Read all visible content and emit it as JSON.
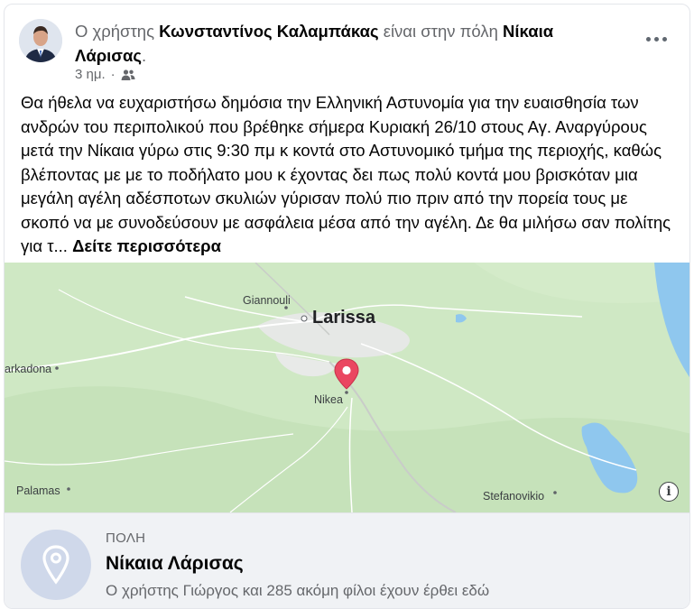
{
  "post": {
    "header_prefix": "Ο χρήστης",
    "author_name": "Κωνσταντίνος Καλαμπάκας",
    "header_middle": "είναι στην πόλη",
    "location_name": "Νίκαια Λάρισας",
    "header_suffix": ".",
    "time": "3 ημ.",
    "separator": "·",
    "privacy_icon": "friends-icon",
    "more_icon": "more-horizontal-icon",
    "body": "Θα ήθελα να ευχαριστήσω δημόσια την Ελληνική Αστυνομία για την ευαισθησία των ανδρών του περιπολικού που βρέθηκε σήμερα Κυριακή 26/10 στους Αγ. Αναργύρους μετά την Νίκαια γύρω στις 9:30 πμ κ κοντά στο Αστυνομικό τμήμα της περιοχής, καθώς  βλέποντας με με το ποδήλατο μου κ έχοντας δει πως πολύ κοντά μου βρισκόταν μια μεγάλη αγέλη αδέσποτων σκυλιών γύρισαν πολύ πιο πριν από την πορεία τους με σκοπό να με συνοδεύσουν με ασφάλεια μέσα από την αγέλη. Δε θα μιλήσω σαν πολίτης για τ...",
    "see_more": "Δείτε περισσότερα"
  },
  "map": {
    "labels": {
      "larissa": "Larissa",
      "giannouli": "Giannouli",
      "farkadona": "arkadona",
      "nikea": "Nikea",
      "palamas": "Palamas",
      "stefanovikio": "Stefanovikio"
    },
    "info_glyph": "i",
    "colors": {
      "land": "#cfe8c4",
      "urban": "#e6e8e6",
      "water": "#8fc7ee",
      "road": "#f4f4f4",
      "pin": "#ea4761"
    }
  },
  "place": {
    "category": "ΠΟΛΗ",
    "name": "Νίκαια Λάρισας",
    "visits": "Ο χρήστης Γιώργος και 285 ακόμη φίλοι έχουν έρθει εδώ",
    "icon": "location-pin-icon"
  }
}
